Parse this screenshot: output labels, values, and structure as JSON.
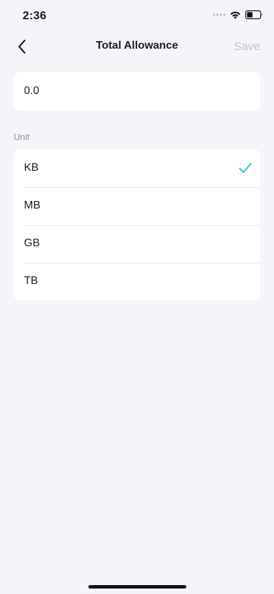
{
  "status_bar": {
    "time": "2:36"
  },
  "nav": {
    "title": "Total Allowance",
    "save_label": "Save"
  },
  "allowance": {
    "value": "0.0"
  },
  "unit_section": {
    "label": "Unit",
    "options": [
      {
        "label": "KB",
        "selected": true
      },
      {
        "label": "MB",
        "selected": false
      },
      {
        "label": "GB",
        "selected": false
      },
      {
        "label": "TB",
        "selected": false
      }
    ]
  },
  "colors": {
    "background": "#f4f5f9",
    "card": "#ffffff",
    "accent_check": "#3ec4cf",
    "save_disabled": "#c3c6cc",
    "section_label": "#8e9096"
  }
}
